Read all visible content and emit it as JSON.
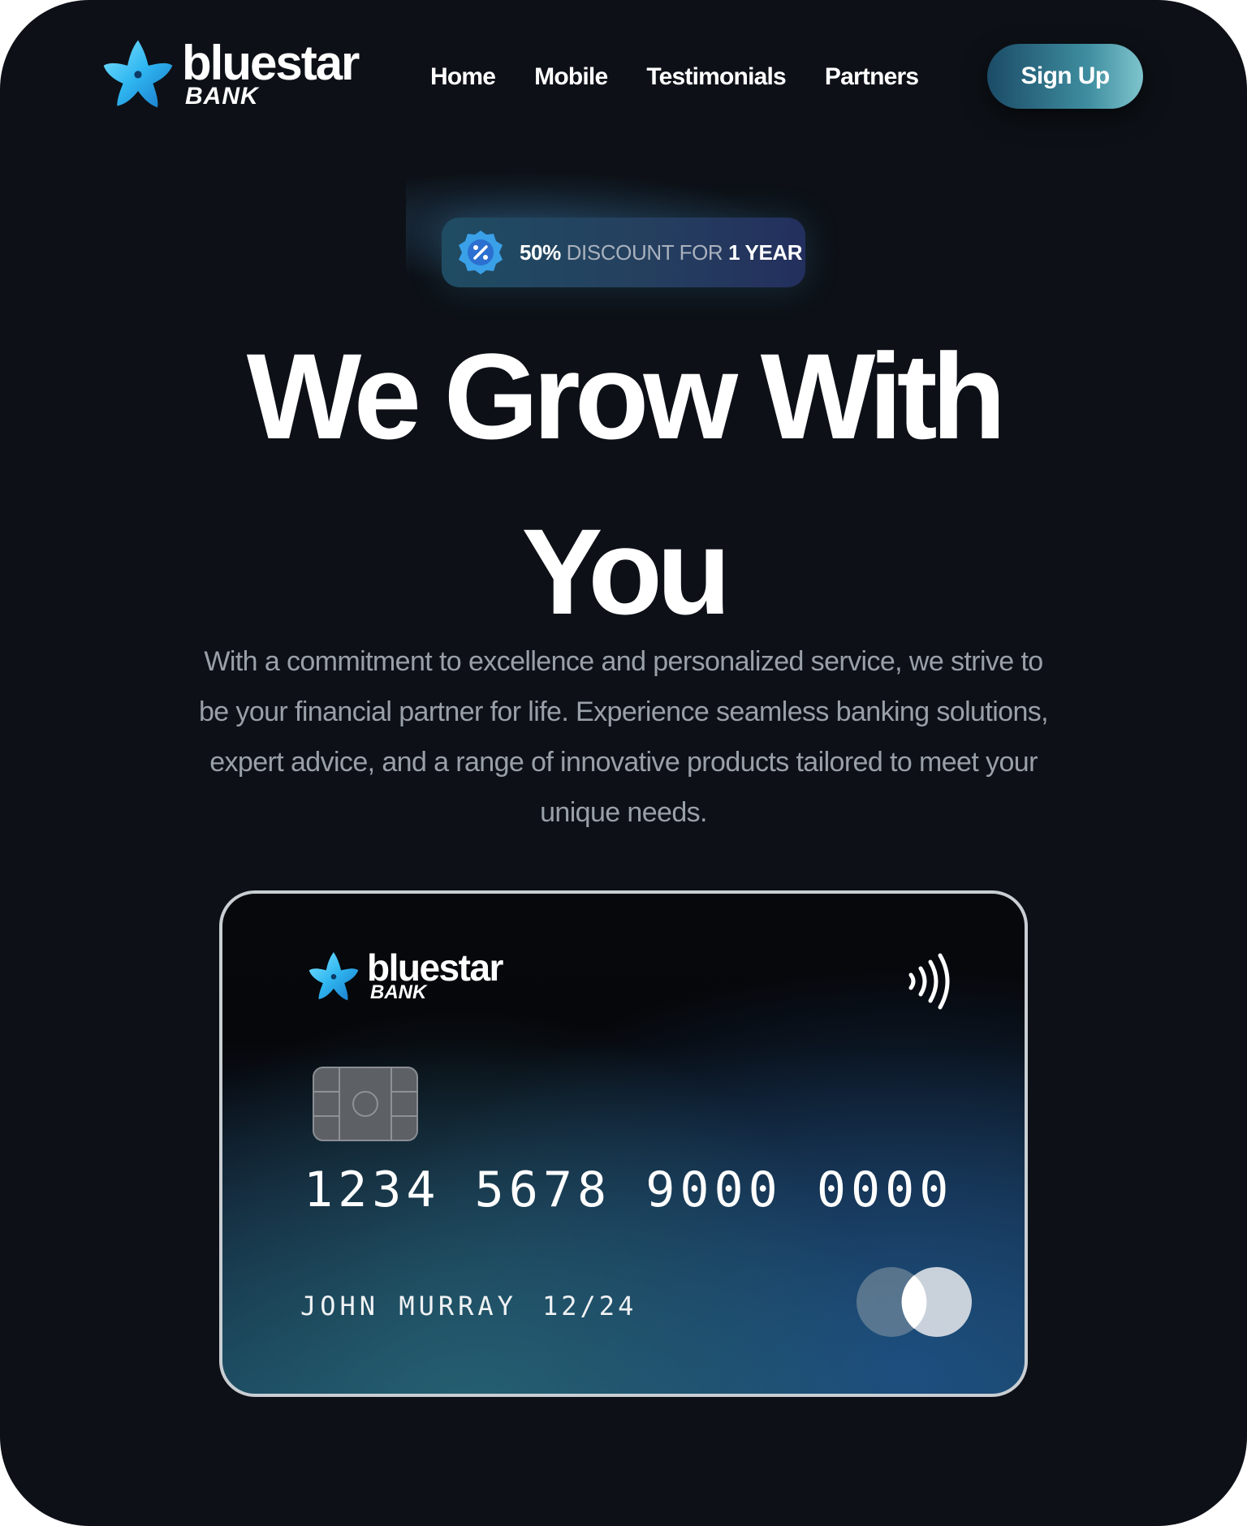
{
  "brand": {
    "name": "bluestar",
    "sub": "BANK"
  },
  "nav": {
    "links": [
      {
        "label": "Home"
      },
      {
        "label": "Mobile"
      },
      {
        "label": "Testimonials"
      },
      {
        "label": "Partners"
      }
    ],
    "signup_label": "Sign Up"
  },
  "badge": {
    "icon": "discount-percent-icon",
    "percent": "50%",
    "middle": " DISCOUNT FOR ",
    "duration": "1 YEAR"
  },
  "hero": {
    "title_line1": "We Grow With",
    "title_line2": "You",
    "description": "With a commitment to excellence and personalized service, we strive to be your financial partner for life. Experience seamless banking solutions, expert advice, and a range of innovative products tailored to meet your unique needs."
  },
  "card": {
    "brand_name": "bluestar",
    "brand_sub": "BANK",
    "number": "1234 5678 9000 0000",
    "holder": "JOHN MURRAY",
    "expiry": "12/24",
    "icons": [
      "contactless-icon",
      "chip-icon",
      "mastercard-logo-icon"
    ]
  },
  "colors": {
    "background": "#0d1117",
    "accent": "#3f8ea0",
    "badge": "#25405f",
    "text_muted": "#9aa0a8"
  }
}
